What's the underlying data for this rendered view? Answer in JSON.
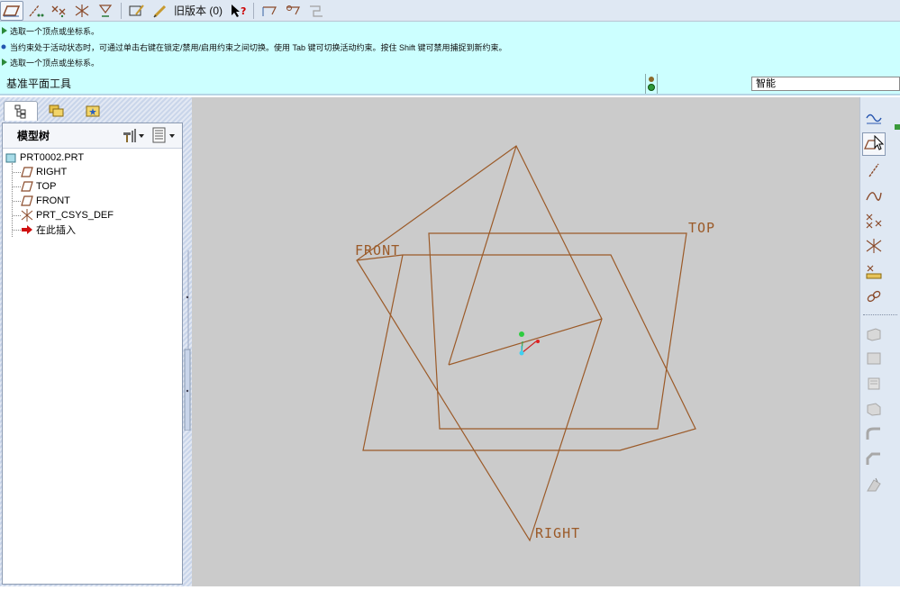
{
  "toolbar": {
    "legacy_label": "旧版本 (0)"
  },
  "messages": [
    {
      "type": "prompt",
      "text": "选取一个顶点或坐标系。"
    },
    {
      "type": "info",
      "text": "当约束处于活动状态时，可通过单击右键在锁定/禁用/启用约束之间切换。使用 Tab 键可切换活动约束。按住 Shift 键可禁用捕捉到新约束。"
    },
    {
      "type": "prompt",
      "text": "选取一个顶点或坐标系。"
    }
  ],
  "tool_name": "基准平面工具",
  "filter": {
    "value": "智能"
  },
  "navigator": {
    "tree_label": "模型树",
    "items": [
      {
        "label": "PRT0002.PRT",
        "icon": "part-icon"
      },
      {
        "label": "RIGHT",
        "icon": "datum-plane-icon"
      },
      {
        "label": "TOP",
        "icon": "datum-plane-icon"
      },
      {
        "label": "FRONT",
        "icon": "datum-plane-icon"
      },
      {
        "label": "PRT_CSYS_DEF",
        "icon": "csys-icon"
      },
      {
        "label": "在此插入",
        "icon": "insert-here-arrow-icon"
      }
    ]
  },
  "viewport": {
    "planes": [
      "FRONT",
      "TOP",
      "RIGHT"
    ],
    "plane_color": "#9b5a28"
  }
}
